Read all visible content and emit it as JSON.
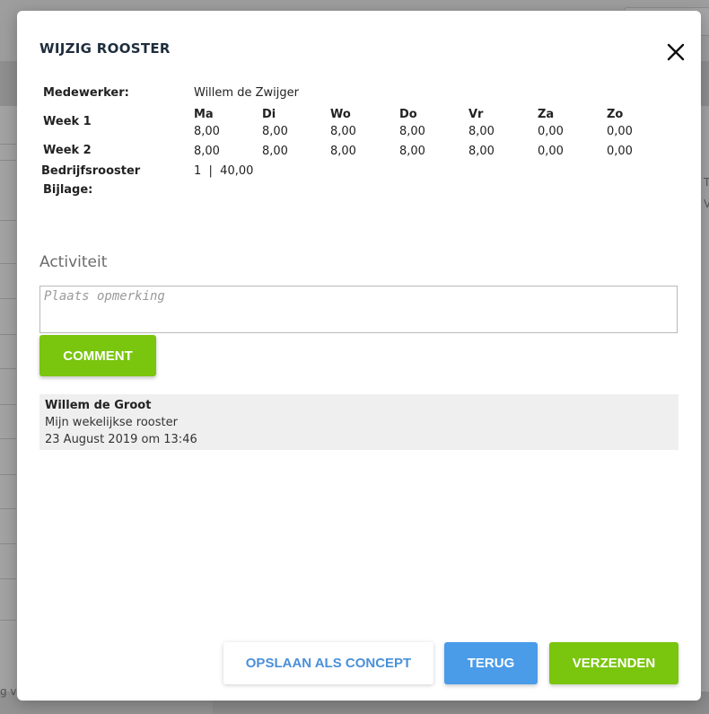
{
  "background": {
    "side_text_1": "T",
    "side_text_2": "V",
    "left_text": "g va"
  },
  "modal": {
    "title": "WIJZIG ROOSTER",
    "close_icon": "close-icon"
  },
  "info": {
    "employee_label": "Medewerker:",
    "employee_value": "Willem de Zwijger",
    "days": [
      "Ma",
      "Di",
      "Wo",
      "Do",
      "Vr",
      "Za",
      "Zo"
    ],
    "week1_label": "Week 1",
    "week1_values": [
      "8,00",
      "8,00",
      "8,00",
      "8,00",
      "8,00",
      "0,00",
      "0,00"
    ],
    "week2_label": "Week 2",
    "week2_values": [
      "8,00",
      "8,00",
      "8,00",
      "8,00",
      "8,00",
      "0,00",
      "0,00"
    ],
    "company_schedule_label": "Bedrijfsrooster",
    "company_schedule_value": "1  |  40,00",
    "attachment_label": "Bijlage:"
  },
  "activity": {
    "title": "Activiteit",
    "comment_placeholder": "Plaats opmerking",
    "comment_value": "",
    "comment_button": "COMMENT",
    "items": [
      {
        "author": "Willem de Groot",
        "text": "Mijn wekelijkse rooster",
        "date": "23 August 2019 om 13:46"
      }
    ]
  },
  "footer": {
    "save_concept_label": "OPSLAAN ALS CONCEPT",
    "back_label": "TERUG",
    "send_label": "VERZENDEN"
  },
  "colors": {
    "green": "#7ac50e",
    "blue": "#4a9be8",
    "link_blue": "#4a90d9"
  }
}
